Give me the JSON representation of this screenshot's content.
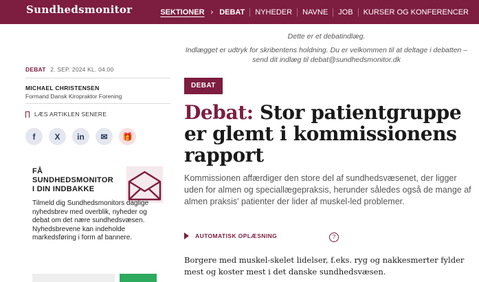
{
  "header": {
    "brand": "Sundhedsmonitor",
    "nav": {
      "sektioner": "SEKTIONER",
      "chevron": "›",
      "debat": "DEBAT",
      "nyheder": "NYHEDER",
      "navne": "NAVNE",
      "job": "JOB",
      "kurser": "KURSER OG KONFERENCER"
    },
    "brand_color": "#7d1d3f"
  },
  "notice": {
    "line1": "Dette er et debatindlæg.",
    "line2": "Indlægget er udtryk for skribentens holdning. Du er velkommen til at deltage i debatten – send dit indlæg til",
    "email": "debat@sundhedsmonitor.dk"
  },
  "meta": {
    "category": "DEBAT",
    "date": "2. SEP. 2024 KL. 04.00"
  },
  "author": {
    "name": "MICHAEL CHRISTENSEN",
    "role": "Formand Dansk Kiropraktor Forening"
  },
  "read_later": "LÆS ARTIKLEN SENERE",
  "share_icons": [
    "facebook-icon",
    "x-icon",
    "linkedin-icon",
    "mail-icon",
    "gift-icon"
  ],
  "share_glyphs": [
    "f",
    "X",
    "in",
    "✉",
    "🎁"
  ],
  "newsletter": {
    "title_line1": "FÅ",
    "title_line2": "SUNDHEDSMONITOR",
    "title_line3": "I DIN INDBAKKE",
    "body": "Tilmeld dig Sundhedsmonitors daglige nyhedsbrev med overblik, nyheder og debat om det nære sundhedsvæsen. Nyhedsbrevene kan indeholde markedsføring i form af bannere."
  },
  "article": {
    "badge": "DEBAT",
    "headline_keyword": "Debat:",
    "headline_rest": "Stor patientgruppe er glemt i kommissionens rapport",
    "lead": "Kommissionen affærdiger den store del af sundhedsvæsenet, der ligger uden for almen og speciallægepraksis, herunder således også de mange af almen praksis' patienter der lider af muskel-led problemer.",
    "audio_label": "AUTOMATISK OPLÆSNING",
    "help": "?",
    "body": "Borgere med muskel-skelet lidelser, f.eks. ryg og nakkesmerter fylder mest og koster mest i det danske sundhedsvæsen."
  }
}
